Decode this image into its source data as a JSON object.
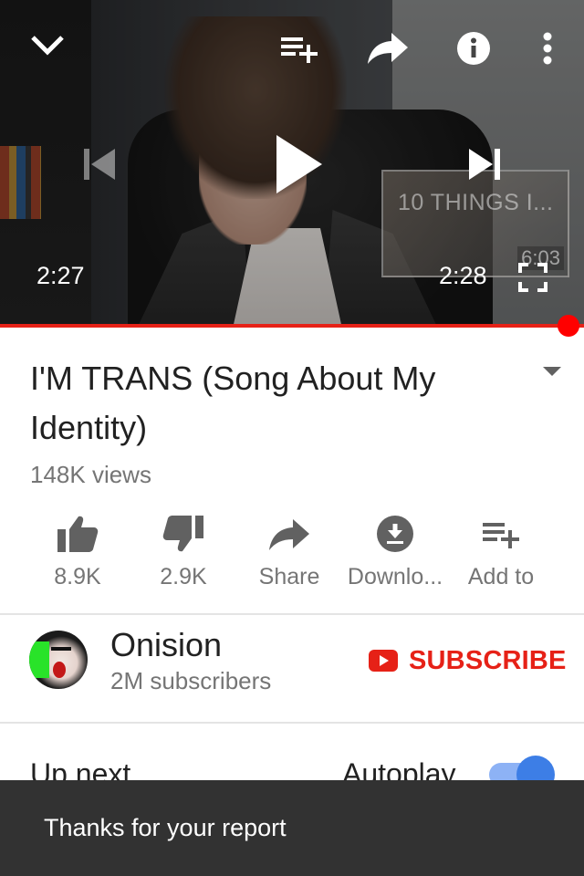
{
  "player": {
    "current_time": "2:27",
    "end_time": "2:28",
    "progress_fraction": 0.97,
    "accent_color": "#e62117",
    "top_controls": [
      "chevron-down-icon",
      "add-to-playlist-icon",
      "share-icon",
      "info-icon",
      "more-vert-icon"
    ],
    "endcard": {
      "title": "10 THINGS I...",
      "duration": "6:03"
    }
  },
  "video": {
    "title": "I'M TRANS (Song About My Identity)",
    "views": "148K views"
  },
  "actions": {
    "like_count": "8.9K",
    "dislike_count": "2.9K",
    "share_label": "Share",
    "download_label": "Downlo...",
    "add_to_label": "Add to"
  },
  "channel": {
    "name": "Onision",
    "subscribers": "2M subscribers",
    "subscribe_label": "SUBSCRIBE",
    "subscribe_color": "#e62117"
  },
  "up_next": {
    "label": "Up next",
    "autoplay_label": "Autoplay",
    "autoplay_on": true
  },
  "snackbar": {
    "message": "Thanks for your report"
  }
}
